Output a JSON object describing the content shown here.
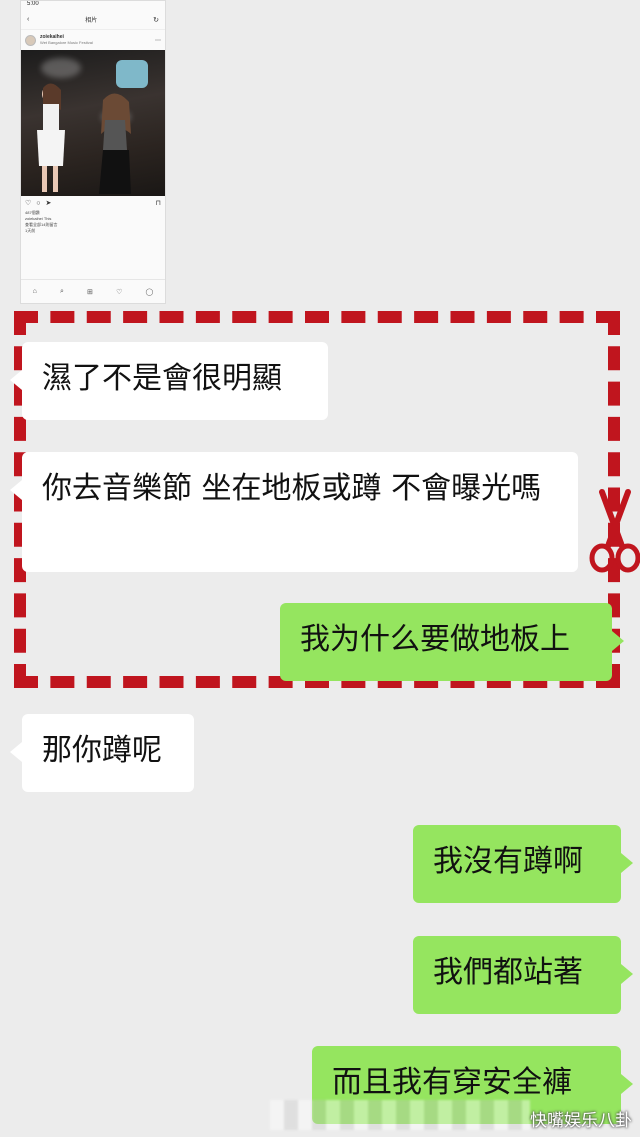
{
  "screenshot_card": {
    "status_time": "5:00",
    "title": "相片",
    "username": "zoiekaihei",
    "location": "Wet Bangalore Music Festival",
    "likes": "487個讚",
    "caption": "zoiekaihei This",
    "comments_link": "查看全部14則留言",
    "time": "1天前"
  },
  "messages": [
    {
      "side": "in",
      "text": "濕了不是會很明顯"
    },
    {
      "side": "in",
      "text": "你去音樂節 坐在地板或蹲 不會曝光嗎"
    },
    {
      "side": "out",
      "text": "我为什么要做地板上"
    },
    {
      "side": "in",
      "text": "那你蹲呢"
    },
    {
      "side": "out",
      "text": "我沒有蹲啊"
    },
    {
      "side": "out",
      "text": "我們都站著"
    },
    {
      "side": "out",
      "text": "而且我有穿安全褲"
    }
  ],
  "watermark": "快嘴娱乐八卦",
  "colors": {
    "background": "#ececec",
    "incoming_bubble": "#ffffff",
    "outgoing_bubble": "#95e55f",
    "frame": "#c0151e"
  }
}
